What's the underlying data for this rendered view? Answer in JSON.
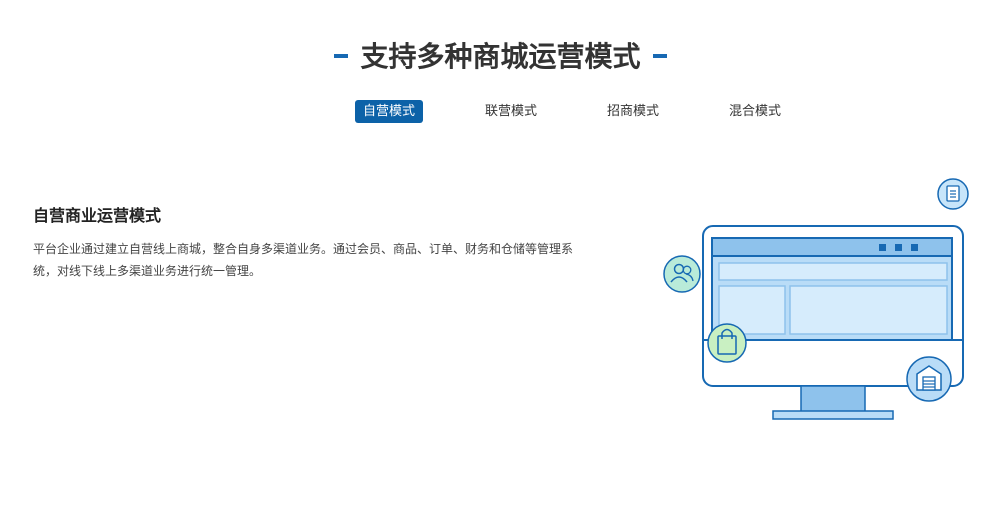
{
  "heading": {
    "title": "支持多种商城运营模式"
  },
  "tabs": [
    {
      "label": "自营模式",
      "active": true
    },
    {
      "label": "联营模式",
      "active": false
    },
    {
      "label": "招商模式",
      "active": false
    },
    {
      "label": "混合模式",
      "active": false
    }
  ],
  "content": {
    "title": "自营商业运营模式",
    "description": "平台企业通过建立自营线上商城，整合自身多渠道业务。通过会员、商品、订单、财务和仓储等管理系统，对线下线上多渠道业务进行统一管理。"
  },
  "illustration": {
    "icons": [
      "document-icon",
      "users-icon",
      "shopping-bag-icon",
      "warehouse-icon"
    ]
  },
  "colors": {
    "accent": "#0c62a8",
    "light_blue": "#b9dcf7"
  }
}
